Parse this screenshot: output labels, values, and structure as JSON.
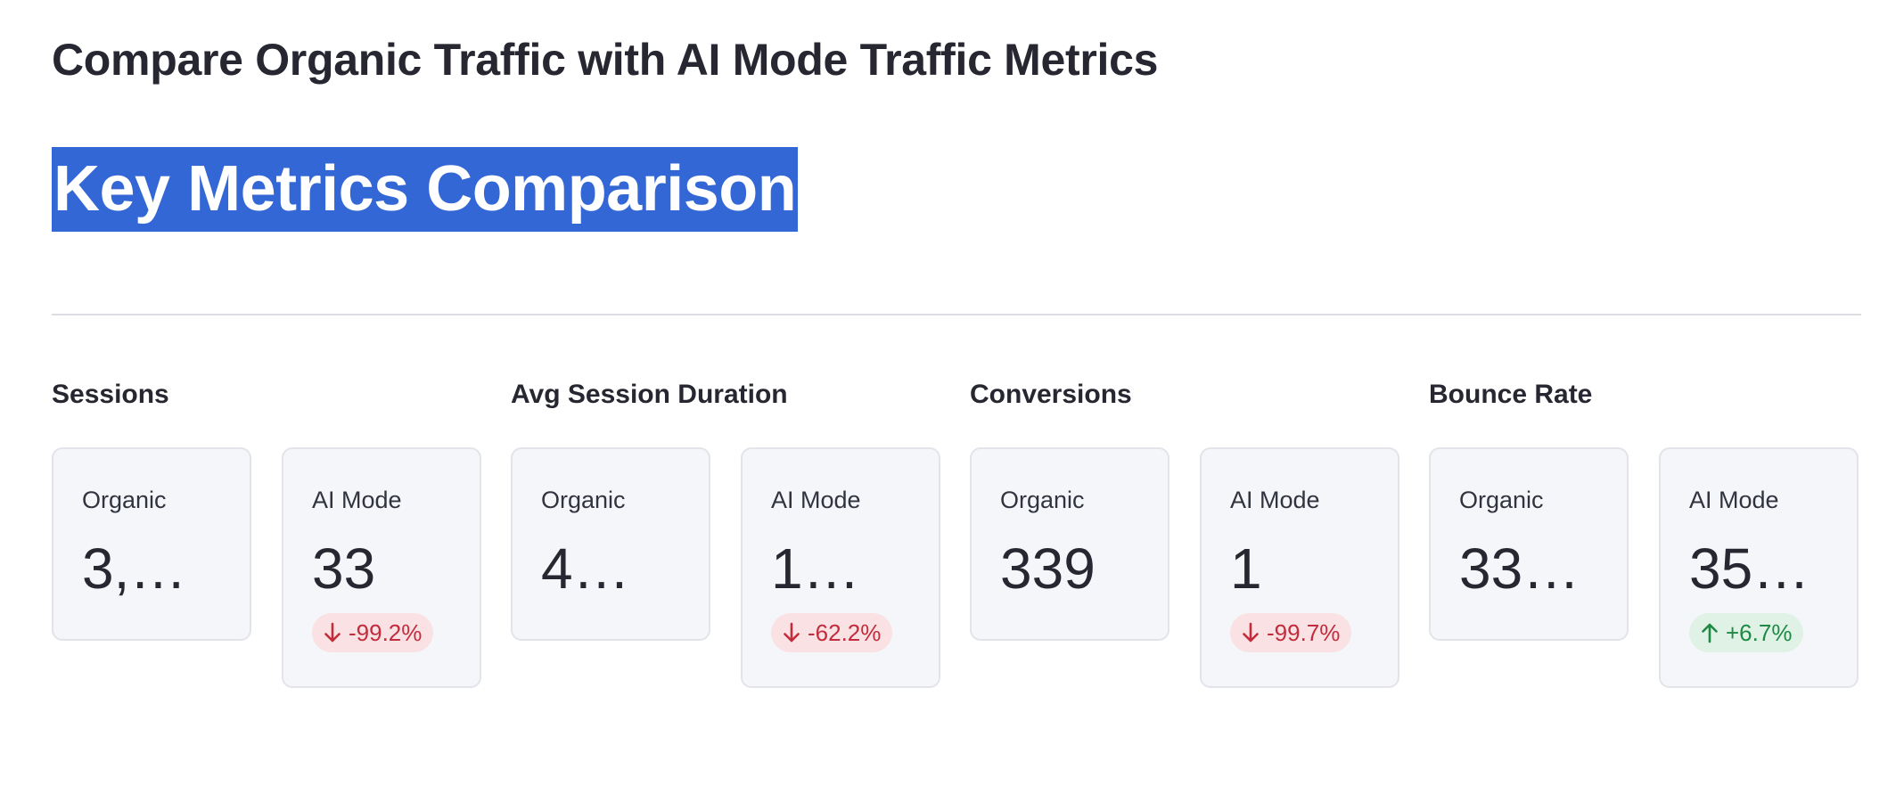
{
  "page": {
    "title": "Compare Organic Traffic with AI Mode Traffic Metrics",
    "section_heading": "Key Metrics Comparison"
  },
  "colors": {
    "heading_highlight": "#3467d6",
    "delta_negative_text": "#c12d3c",
    "delta_negative_bg": "#fae1e3",
    "delta_positive_text": "#1e8a43",
    "delta_positive_bg": "#dff2e5",
    "card_bg": "#f5f6fa"
  },
  "metrics": [
    {
      "label": "Sessions",
      "organic": {
        "label": "Organic",
        "value": "3,…"
      },
      "ai_mode": {
        "label": "AI Mode",
        "value": "33",
        "delta": "-99.2%",
        "direction": "down",
        "icon": "arrow-down-icon"
      }
    },
    {
      "label": "Avg Session Duration",
      "organic": {
        "label": "Organic",
        "value": "4…"
      },
      "ai_mode": {
        "label": "AI Mode",
        "value": "1…",
        "delta": "-62.2%",
        "direction": "down",
        "icon": "arrow-down-icon"
      }
    },
    {
      "label": "Conversions",
      "organic": {
        "label": "Organic",
        "value": "339"
      },
      "ai_mode": {
        "label": "AI Mode",
        "value": "1",
        "delta": "-99.7%",
        "direction": "down",
        "icon": "arrow-down-icon"
      }
    },
    {
      "label": "Bounce Rate",
      "organic": {
        "label": "Organic",
        "value": "33…"
      },
      "ai_mode": {
        "label": "AI Mode",
        "value": "35…",
        "delta": "+6.7%",
        "direction": "up",
        "icon": "arrow-up-icon"
      }
    }
  ]
}
